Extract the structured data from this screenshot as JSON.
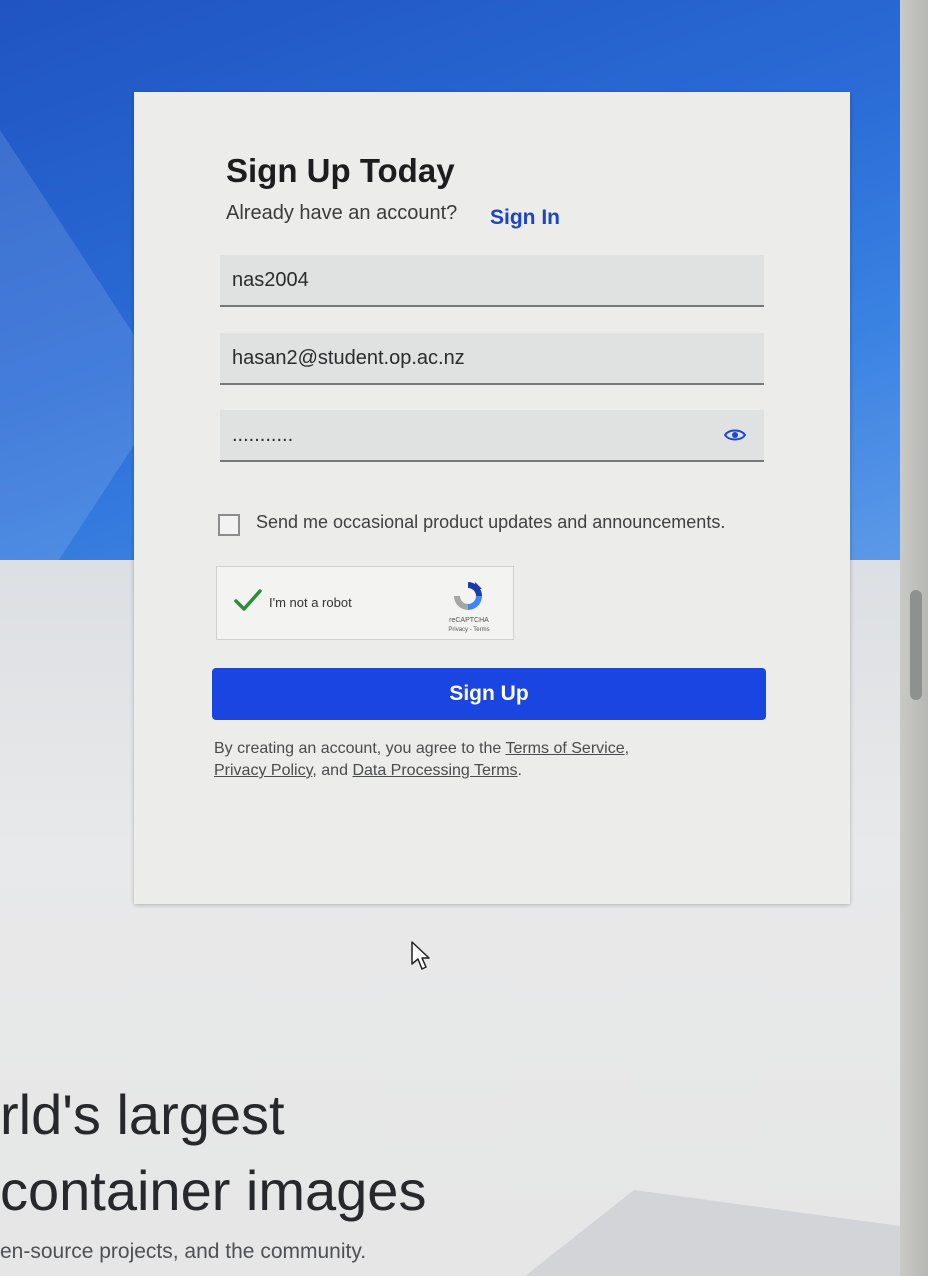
{
  "signup": {
    "title": "Sign Up Today",
    "subtitle": "Already have an account?",
    "signin_link": "Sign In",
    "username_value": "nas2004",
    "email_value": "hasan2@student.op.ac.nz",
    "password_value": "...........",
    "updates_checkbox_label": "Send me occasional product updates and announcements.",
    "updates_checked": false,
    "button_label": "Sign Up",
    "legal": {
      "prefix": "By creating an account, you agree to the",
      "terms_link": "Terms of Service",
      "comma": ",",
      "privacy_link": "Privacy Policy",
      "and_text": ", and",
      "dpt_link": "Data Processing Terms",
      "period": "."
    }
  },
  "captcha": {
    "label": "I'm not a robot",
    "brand": "reCAPTCHA",
    "terms": "Privacy - Terms",
    "checked": true,
    "check_color": "#2e8b3a"
  },
  "hero": {
    "line1": "rld's largest",
    "line2": "container images",
    "sub": "en-source projects, and the community."
  },
  "colors": {
    "primary": "#1a45e0",
    "link": "#1c44c7"
  }
}
